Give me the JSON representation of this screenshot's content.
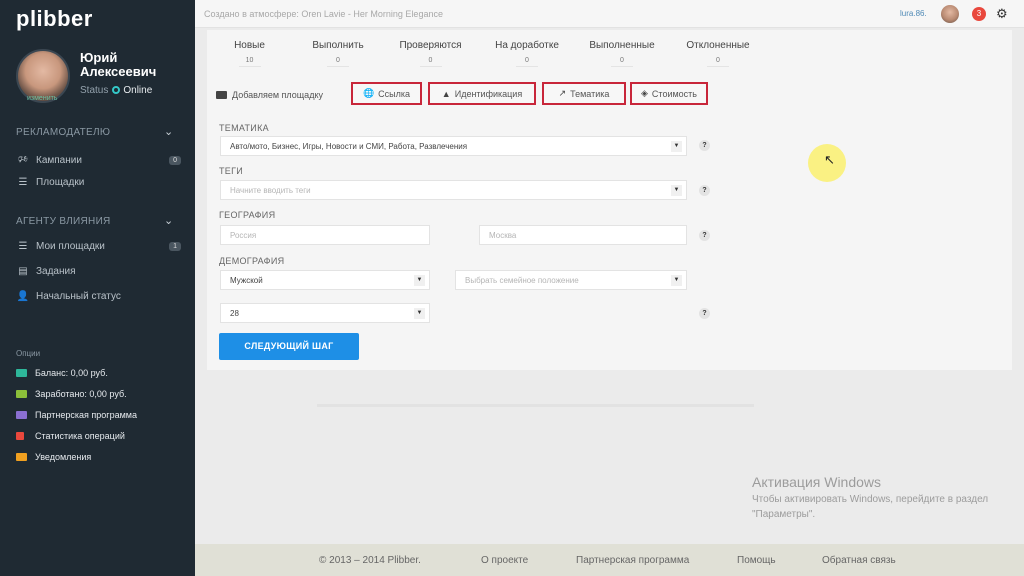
{
  "sidebar": {
    "logo": "plibber",
    "user": {
      "name_first": "Юрий",
      "name_last": "Алексеевич",
      "status_label": "Status",
      "status_value": "Online",
      "change_link": "изменить"
    },
    "advertiser": {
      "title": "РЕКЛАМОДАТЕЛЮ",
      "items": [
        {
          "label": "Кампании",
          "badge": "0",
          "icon": "megaphone-icon"
        },
        {
          "label": "Площадки",
          "icon": "list-icon"
        }
      ]
    },
    "agent": {
      "title": "АГЕНТУ ВЛИЯНИЯ",
      "items": [
        {
          "label": "Мои площадки",
          "badge": "1",
          "icon": "list-icon"
        },
        {
          "label": "Задания",
          "icon": "document-icon"
        },
        {
          "label": "Начальный статус",
          "icon": "user-icon"
        }
      ]
    },
    "options": {
      "title": "Опции",
      "items": [
        {
          "label": "Баланс: 0,00 руб.",
          "color": "#2eb79a"
        },
        {
          "label": "Заработано: 0,00 руб.",
          "color": "#8bbf3a"
        },
        {
          "label": "Партнерская программа",
          "color": "#8a6fd1"
        },
        {
          "label": "Статистика операций",
          "color": "#e9483d"
        },
        {
          "label": "Уведомления",
          "color": "#f0a020"
        }
      ]
    }
  },
  "topbar": {
    "now_playing": "Создано в атмосфере: Oren Lavie - Her Morning Elegance",
    "user": "lura.86.",
    "notifications": "3"
  },
  "stats": [
    {
      "label": "Новые",
      "value": "10"
    },
    {
      "label": "Выполнить",
      "value": "0"
    },
    {
      "label": "Проверяются",
      "value": "0"
    },
    {
      "label": "На доработке",
      "value": "0"
    },
    {
      "label": "Выполненные",
      "value": "0"
    },
    {
      "label": "Отклоненные",
      "value": "0"
    }
  ],
  "tabs": {
    "add_site": "Добавляем площадку",
    "link": "Ссылка",
    "identification": "Идентификация",
    "theme": "Тематика",
    "cost": "Стоимость"
  },
  "form": {
    "theme_label": "ТЕМАТИКА",
    "theme_value": "Авто/мото, Бизнес, Игры, Новости и СМИ, Работа, Развлечения",
    "tags_label": "ТЕГИ",
    "tags_placeholder": "Начните вводить теги",
    "geo_label": "ГЕОГРАФИЯ",
    "country": "Россия",
    "city": "Москва",
    "demo_label": "ДЕМОГРАФИЯ",
    "gender": "Мужской",
    "marital_placeholder": "Выбрать семейное положение",
    "age": "28",
    "help_glyph": "?",
    "next_button": "СЛЕДУЮЩИЙ ШАГ"
  },
  "windows_notice": {
    "title": "Активация Windows",
    "text": "Чтобы активировать Windows, перейдите в раздел \"Параметры\"."
  },
  "footer": {
    "copyright": "© 2013 – 2014 Plibber.",
    "about": "О проекте",
    "partner": "Партнерская программа",
    "help": "Помощь",
    "feedback": "Обратная связь"
  }
}
